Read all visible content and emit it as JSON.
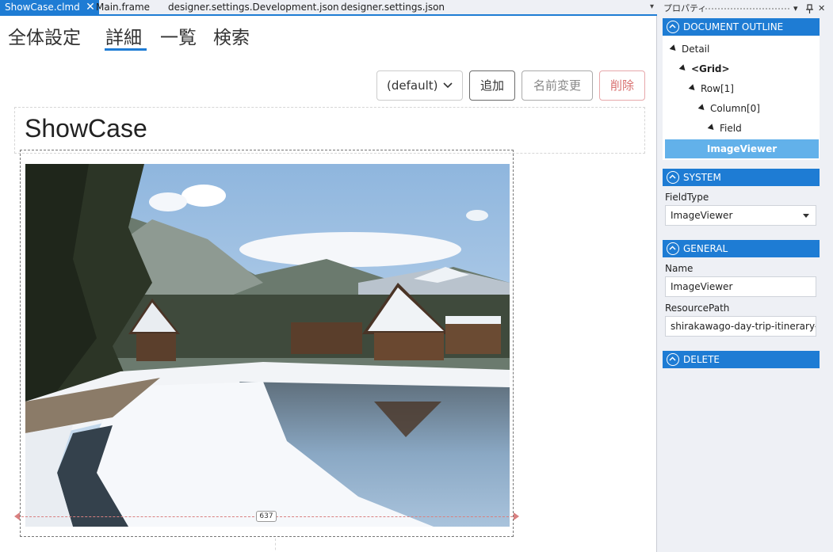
{
  "tabs": [
    {
      "label": "ShowCase.clmd",
      "active": true
    },
    {
      "label": "Main.frame"
    },
    {
      "label": "designer.settings.Development.json"
    },
    {
      "label": "designer.settings.json"
    }
  ],
  "nav": [
    {
      "label": "全体設定"
    },
    {
      "label": "詳細",
      "active": true
    },
    {
      "label": "一覧"
    },
    {
      "label": "検索"
    }
  ],
  "toolbar": {
    "dropdown_value": "(default)",
    "add_label": "追加",
    "rename_label": "名前変更",
    "delete_label": "削除"
  },
  "page": {
    "title": "ShowCase",
    "image_width_label": "637"
  },
  "panel": {
    "title": "プロパティ",
    "outline_section": "DOCUMENT OUTLINE",
    "tree": [
      {
        "label": "Detail"
      },
      {
        "label": "<Grid>"
      },
      {
        "label": "Row[1]"
      },
      {
        "label": "Column[0]"
      },
      {
        "label": "Field"
      }
    ],
    "tree_selected": "ImageViewer",
    "system_section": "SYSTEM",
    "fieldtype_label": "FieldType",
    "fieldtype_value": "ImageViewer",
    "general_section": "GENERAL",
    "name_label": "Name",
    "name_value": "ImageViewer",
    "resourcepath_label": "ResourcePath",
    "resourcepath_value": "shirakawago-day-trip-itinerary-feature",
    "delete_section": "DELETE"
  },
  "colors": {
    "accent": "#1e7cd4",
    "selected": "#62b1ea",
    "delete_button": "#d9706f"
  }
}
